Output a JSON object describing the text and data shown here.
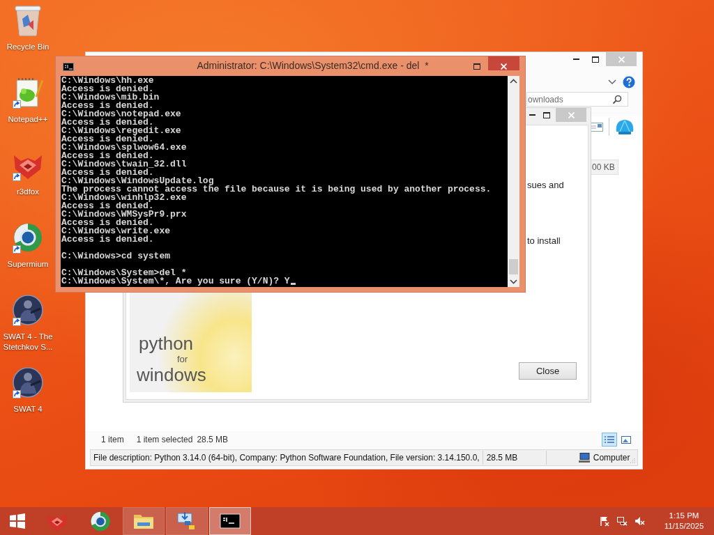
{
  "desktop_icons": [
    {
      "kind": "recycle-bin",
      "label": "Recycle Bin",
      "shortcut": false
    },
    {
      "kind": "notepad",
      "label": "Notepad++",
      "shortcut": true
    },
    {
      "kind": "fox",
      "label": "r3dfox",
      "shortcut": true
    },
    {
      "kind": "globe",
      "label": "Supermium",
      "shortcut": true
    },
    {
      "kind": "game",
      "label": "SWAT 4 - The Stetchkov S...",
      "shortcut": true
    },
    {
      "kind": "game",
      "label": "SWAT 4",
      "shortcut": true
    }
  ],
  "explorer": {
    "search": {
      "placeholder": "ownloads"
    },
    "size_cell": "00 KB",
    "installer": {
      "lines": [
        "sues and",
        "to install"
      ],
      "banner": [
        "python",
        "for",
        "windows"
      ],
      "close_button": "Close"
    },
    "status": {
      "items": "1 item",
      "selected": "1 item selected",
      "size": "28.5 MB"
    },
    "view_buttons": [
      {
        "kind": "details",
        "selected": true
      },
      {
        "kind": "large-icons",
        "selected": false
      }
    ],
    "details_bar": {
      "description": "File description: Python 3.14.0 (64-bit), Company: Python Software Foundation, File version: 3.14.150.0,",
      "size": "28.5 MB",
      "location": "Computer"
    }
  },
  "console": {
    "title": "Administrator: C:\\Windows\\System32\\cmd.exe - del  *",
    "blocks": [
      [
        "C:\\Windows\\hh.exe",
        "Access is denied.",
        "C:\\Windows\\mib.bin",
        "Access is denied.",
        "C:\\Windows\\notepad.exe",
        "Access is denied.",
        "C:\\Windows\\regedit.exe",
        "Access is denied.",
        "C:\\Windows\\splwow64.exe",
        "Access is denied.",
        "C:\\Windows\\twain_32.dll",
        "Access is denied.",
        "C:\\Windows\\WindowsUpdate.log",
        "The process cannot access the file because it is being used by another process.",
        "C:\\Windows\\winhlp32.exe",
        "Access is denied.",
        "C:\\Windows\\WMSysPr9.prx",
        "Access is denied.",
        "C:\\Windows\\write.exe",
        "Access is denied."
      ],
      [
        "C:\\Windows>cd system"
      ],
      [
        "C:\\Windows\\System>del *",
        "C:\\Windows\\System\\*, Are you sure (Y/N)? Y"
      ]
    ]
  },
  "taskbar": {
    "items": [
      {
        "kind": "start",
        "running": false,
        "active": false
      },
      {
        "kind": "fox",
        "running": false,
        "active": false
      },
      {
        "kind": "globe",
        "running": false,
        "active": false
      },
      {
        "kind": "folder",
        "running": true,
        "active": false
      },
      {
        "kind": "installer",
        "running": true,
        "active": false
      },
      {
        "kind": "console",
        "running": true,
        "active": true
      }
    ],
    "tray": [
      {
        "kind": "flag"
      },
      {
        "kind": "network"
      },
      {
        "kind": "speaker"
      }
    ],
    "clock": {
      "time": "1:15 PM",
      "date": "11/15/2025"
    }
  }
}
